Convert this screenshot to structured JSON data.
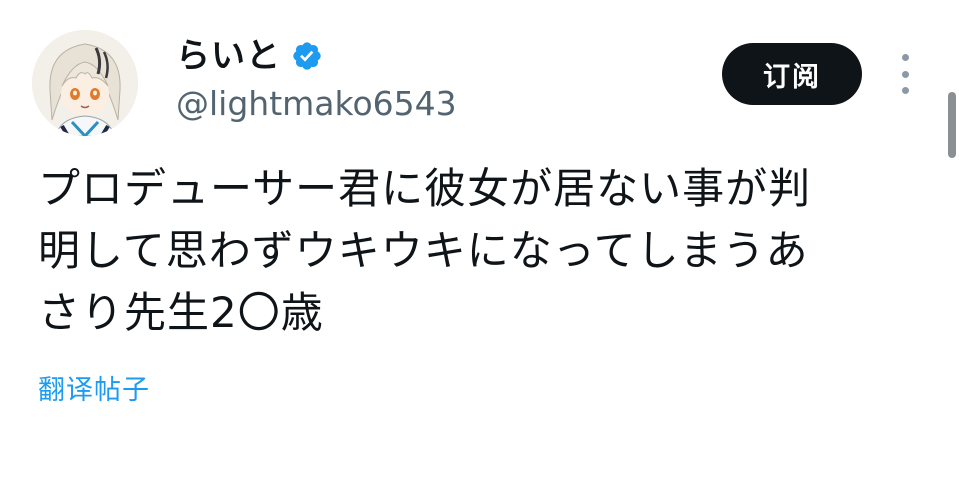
{
  "user": {
    "display_name": "らいと",
    "verified_icon": "verified-badge-icon",
    "handle": "@lightmako6543",
    "avatar_icon": "anime-character-avatar"
  },
  "actions": {
    "subscribe_label": "订阅",
    "more_icon": "more-vertical-icon"
  },
  "tweet": {
    "lines": [
      "プロデューサー君に彼女が居ない事が判",
      "明して思わずウキウキになってしまうあ",
      "さり先生2〇歳"
    ]
  },
  "translate_label": "翻译帖子",
  "colors": {
    "text": "#0f1419",
    "secondary_text": "#536471",
    "accent": "#1d9bf0",
    "button_bg": "#0f1419",
    "button_text": "#ffffff"
  }
}
